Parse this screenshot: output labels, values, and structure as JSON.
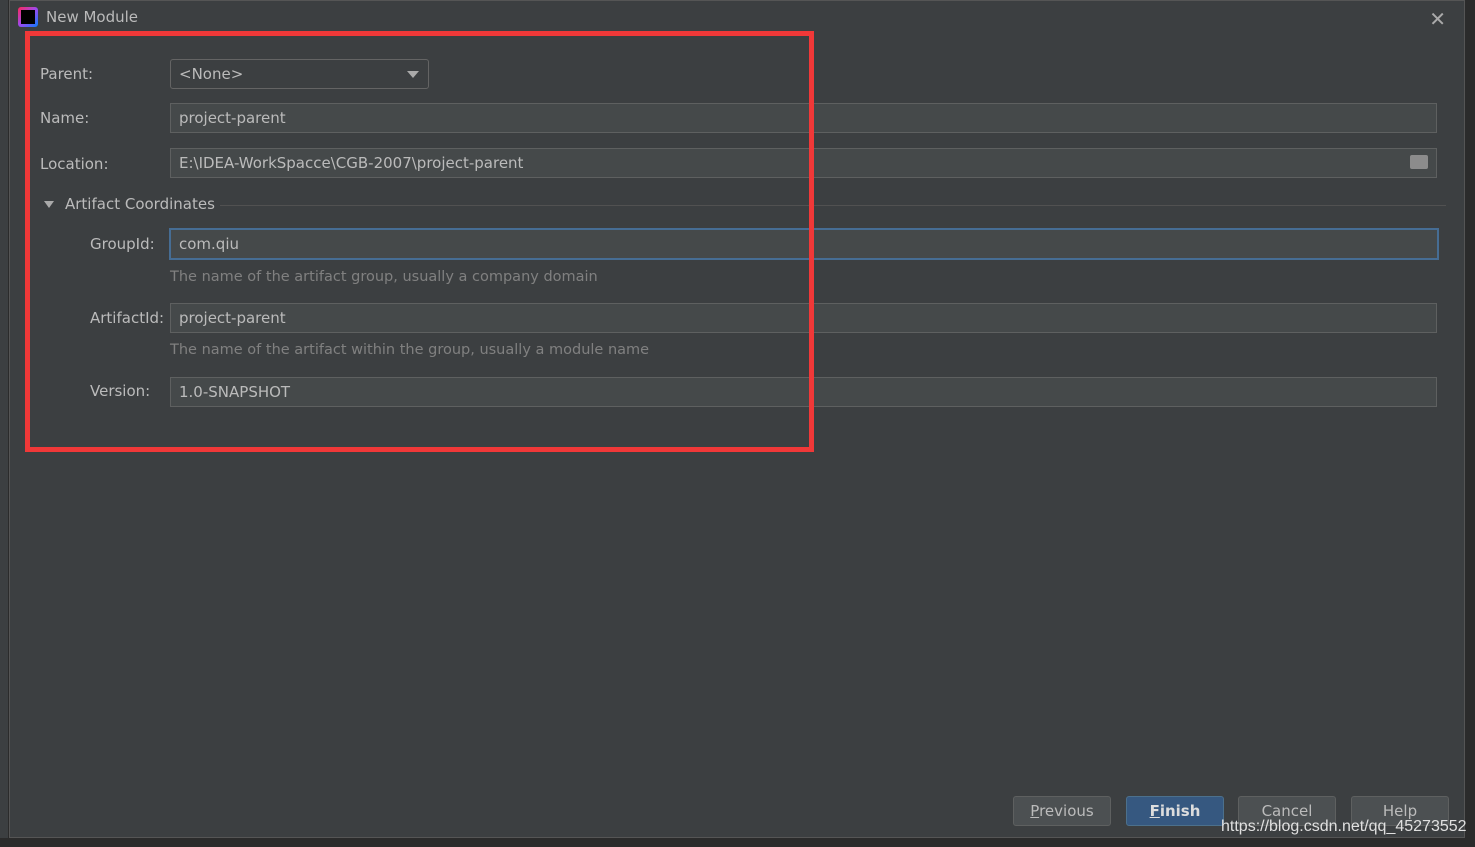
{
  "window": {
    "title": "New Module",
    "close_icon": "close-icon"
  },
  "form": {
    "parent": {
      "label": "Parent:",
      "value": "<None>"
    },
    "name": {
      "label": "Name:",
      "value": "project-parent"
    },
    "location": {
      "label": "Location:",
      "value": "E:\\IDEA-WorkSpacce\\CGB-2007\\project-parent"
    },
    "section": {
      "label": "Artifact Coordinates",
      "expanded": true
    },
    "group_id": {
      "label": "GroupId:",
      "value": "com.qiu",
      "hint": "The name of the artifact group, usually a company domain"
    },
    "artifact_id": {
      "label": "ArtifactId:",
      "value": "project-parent",
      "hint": "The name of the artifact within the group, usually a module name"
    },
    "version": {
      "label": "Version:",
      "value": "1.0-SNAPSHOT"
    }
  },
  "buttons": {
    "previous_m": "P",
    "previous_rest": "revious",
    "finish_m": "F",
    "finish_rest": "inish",
    "cancel": "Cancel",
    "help": "Help"
  },
  "watermark": "https://blog.csdn.net/qq_45273552",
  "colors": {
    "highlight_box": "#f03838",
    "primary": "#365880",
    "focus": "#466d94"
  }
}
